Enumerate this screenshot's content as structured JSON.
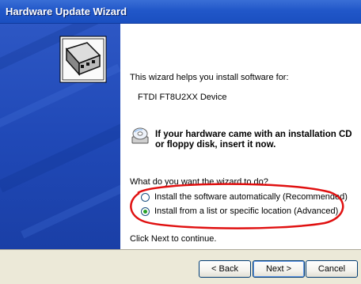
{
  "window": {
    "title": "Hardware Update Wizard"
  },
  "content": {
    "intro": "This wizard helps you install software for:",
    "device": "FTDI FT8U2XX Device",
    "cd_prompt_line1": "If your hardware came with an installation CD",
    "cd_prompt_line2": "or floppy disk, insert it now.",
    "question": "What do you want the wizard to do?",
    "options": [
      {
        "label": "Install the software automatically (Recommended)",
        "selected": false
      },
      {
        "label": "Install from a list or specific location (Advanced)",
        "selected": true
      }
    ],
    "continue_text": "Click Next to continue."
  },
  "buttons": {
    "back": "< Back",
    "next": "Next >",
    "cancel": "Cancel"
  },
  "icons": {
    "side": "hardware-card-icon",
    "cd": "cd-disk-icon"
  },
  "colors": {
    "title_bar": "#2157c9",
    "side_panel": "#2049b7",
    "annotation": "#e01010",
    "radio_dot": "#27a027"
  }
}
